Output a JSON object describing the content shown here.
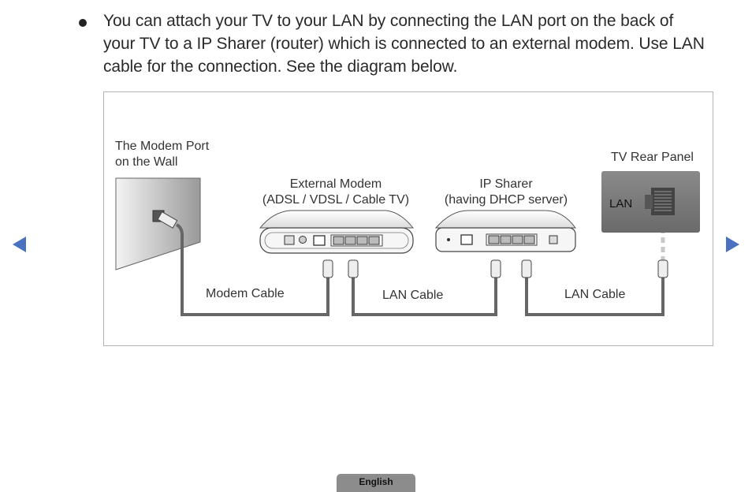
{
  "content": {
    "bullet_text": "You can attach your TV to your LAN by connecting the LAN port on the back of your TV to a IP Sharer (router) which is connected to an external modem. Use LAN cable for the connection. See the diagram below."
  },
  "diagram": {
    "wall_label_line1": "The Modem Port",
    "wall_label_line2": "on the Wall",
    "modem_label_line1": "External Modem",
    "modem_label_line2": "(ADSL / VDSL / Cable TV)",
    "sharer_label_line1": "IP Sharer",
    "sharer_label_line2": "(having DHCP server)",
    "tv_label": "TV Rear Panel",
    "tv_port_label": "LAN",
    "cable1_label": "Modem Cable",
    "cable2_label": "LAN Cable",
    "cable3_label": "LAN Cable"
  },
  "nav": {
    "prev_icon": "triangle-left",
    "next_icon": "triangle-right",
    "color": "#4a72c0"
  },
  "footer": {
    "language_label": "English"
  }
}
